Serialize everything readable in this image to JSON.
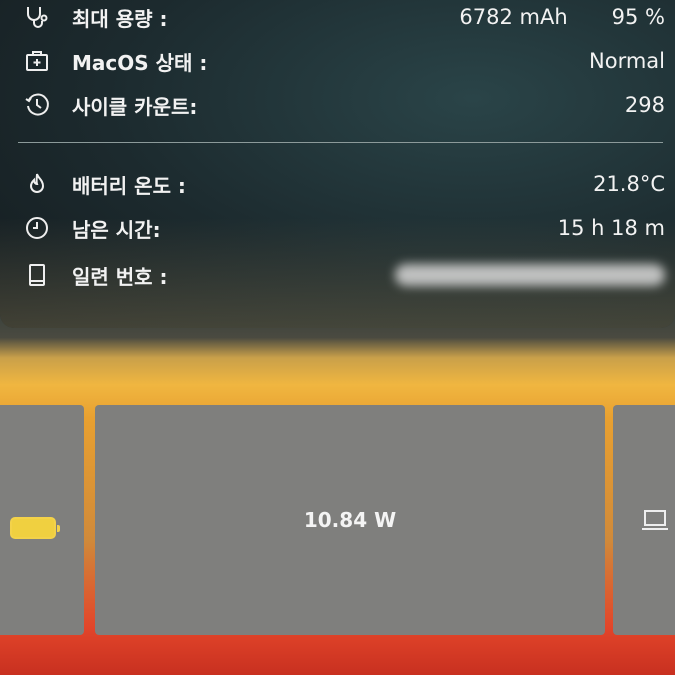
{
  "info": {
    "rows": [
      {
        "icon": "stethoscope-icon",
        "label": "최대 용량 :",
        "value": "6782 mAh",
        "extra": "95 %"
      },
      {
        "icon": "medical-kit-icon",
        "label": "MacOS 상태 :",
        "value": "Normal"
      },
      {
        "icon": "history-clock-icon",
        "label": "사이클 카운트:",
        "value": "298"
      },
      {
        "icon": "flame-icon",
        "label": "배터리 온도 :",
        "value": "21.8°C"
      },
      {
        "icon": "clock-icon",
        "label": "남은 시간:",
        "value": "15 h 18 m"
      },
      {
        "icon": "tablet-icon",
        "label": "일련 번호 :",
        "value": ""
      }
    ]
  },
  "power": {
    "value": "10.84 W",
    "battery_color": "#f0d040"
  }
}
